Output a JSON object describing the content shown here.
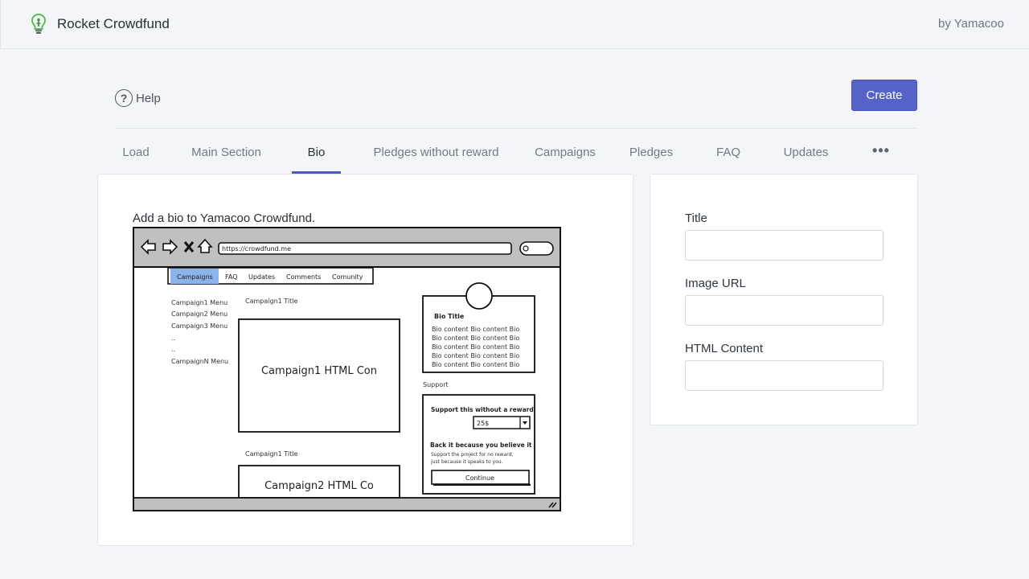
{
  "header": {
    "app_title": "Rocket Crowdfund",
    "logo_icon": "lightbulb-icon",
    "by_line": "by Yamacoo"
  },
  "toolbar": {
    "help_label": "Help",
    "help_icon": "question-circle-icon",
    "create_label": "Create"
  },
  "tabs": [
    {
      "label": "Load",
      "active": false
    },
    {
      "label": "Main Section",
      "active": false
    },
    {
      "label": "Bio",
      "active": true
    },
    {
      "label": "Pledges without reward",
      "active": false
    },
    {
      "label": "Campaigns",
      "active": false
    },
    {
      "label": "Pledges",
      "active": false
    },
    {
      "label": "FAQ",
      "active": false
    },
    {
      "label": "Updates",
      "active": false
    }
  ],
  "more_tabs_icon": "more-horizontal-icon",
  "more_tabs_label": "•••",
  "bio": {
    "description": "Add a bio to Yamacoo Crowdfund.",
    "wireframe": {
      "url": "https://crowdfund.me",
      "nav": [
        "Campaigns",
        "FAQ",
        "Updates",
        "Comments",
        "Comunity"
      ],
      "menu": [
        "Campaign1 Menu",
        "Campaign2 Menu",
        "Campaign3 Menu",
        "..",
        "..",
        "CampaignN Menu"
      ],
      "campaign1_title": "Campaign1 Title",
      "campaign1_content": "Campaign1 HTML Con",
      "campaign2_title": "Campaign1 Title",
      "campaign2_content": "Campaign2 HTML Co",
      "bio_title": "Bio Title",
      "bio_lines": [
        "Bio content Bio content Bio",
        "Bio content Bio content Bio",
        "Bio content Bio content Bio",
        "Bio content Bio content Bio",
        "Bio content Bio content Bio"
      ],
      "support_label": "Support",
      "support_heading": "Support this without a reward",
      "amount": "25$",
      "back_heading": "Back it because you believe it",
      "back_text_1": "Support the project for no reward,",
      "back_text_2": "just because it speaks to you.",
      "continue_label": "Continue"
    }
  },
  "form": {
    "title_label": "Title",
    "title_value": "",
    "image_url_label": "Image URL",
    "image_url_value": "",
    "html_content_label": "HTML Content",
    "html_content_value": ""
  },
  "colors": {
    "accent": "#5562c8",
    "logo": "#5cc04f",
    "wireframe_nav_active": "#8cb4ec"
  }
}
